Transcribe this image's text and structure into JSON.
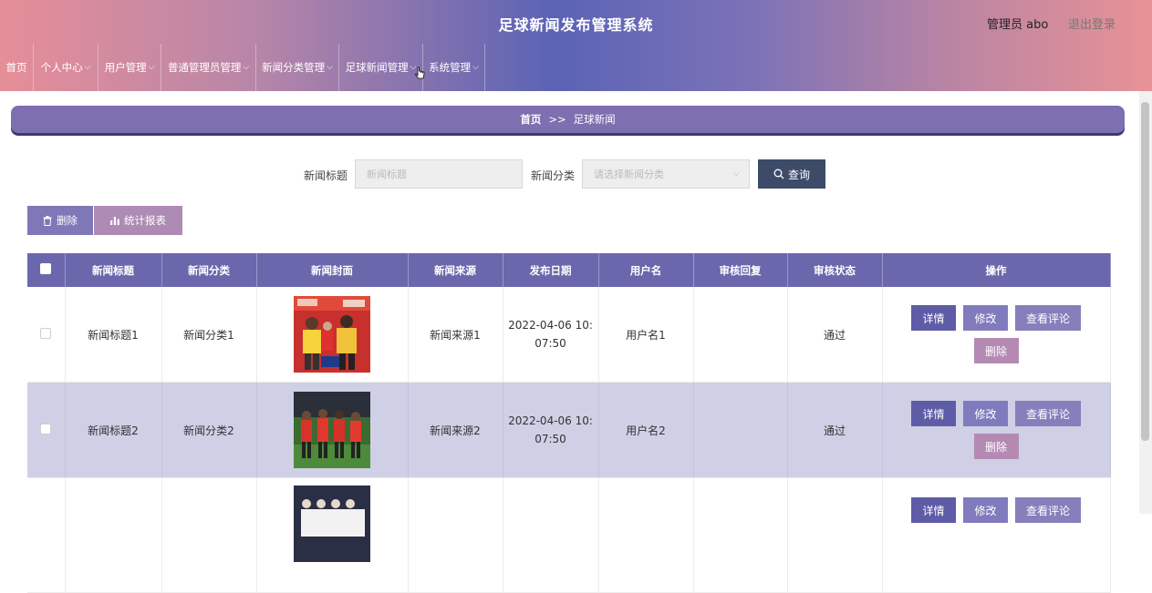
{
  "header": {
    "title": "足球新闻发布管理系统",
    "admin": "管理员 abo",
    "logout": "退出登录"
  },
  "nav": [
    {
      "label": "首页",
      "has_dropdown": false
    },
    {
      "label": "个人中心",
      "has_dropdown": true
    },
    {
      "label": "用户管理",
      "has_dropdown": true
    },
    {
      "label": "普通管理员管理",
      "has_dropdown": true
    },
    {
      "label": "新闻分类管理",
      "has_dropdown": true
    },
    {
      "label": "足球新闻管理",
      "has_dropdown": true
    },
    {
      "label": "系统管理",
      "has_dropdown": true
    }
  ],
  "breadcrumb": {
    "home": "首页",
    "separator": ">>",
    "current": "足球新闻"
  },
  "search": {
    "title_label": "新闻标题",
    "title_placeholder": "新闻标题",
    "category_label": "新闻分类",
    "category_placeholder": "请选择新闻分类",
    "query_button": "查询"
  },
  "actions": {
    "delete": "删除",
    "stats_report": "统计报表"
  },
  "table": {
    "headers": [
      "新闻标题",
      "新闻分类",
      "新闻封面",
      "新闻来源",
      "发布日期",
      "用户名",
      "审核回复",
      "审核状态",
      "操作"
    ],
    "rows": [
      {
        "title": "新闻标题1",
        "category": "新闻分类1",
        "source": "新闻来源1",
        "date_line1": "2022-04-06 10:",
        "date_line2": "07:50",
        "username": "用户名1",
        "reply": "",
        "status": "通过"
      },
      {
        "title": "新闻标题2",
        "category": "新闻分类2",
        "source": "新闻来源2",
        "date_line1": "2022-04-06 10:",
        "date_line2": "07:50",
        "username": "用户名2",
        "reply": "",
        "status": "通过"
      },
      {
        "title": "",
        "category": "",
        "source": "",
        "date_line1": "",
        "date_line2": "",
        "username": "",
        "reply": "",
        "status": ""
      }
    ],
    "ops": {
      "detail": "详情",
      "edit": "修改",
      "comments": "查看评论",
      "delete": "删除"
    }
  },
  "colors": {
    "header_center": "#5b63b5",
    "header_edges": "#e68e98",
    "breadcrumb": "#7d6fb0",
    "table_header": "#6b67ad",
    "alt_row": "#cfcfe6",
    "query_button": "#3d4a68",
    "delete_pink": "#b48ab3"
  }
}
